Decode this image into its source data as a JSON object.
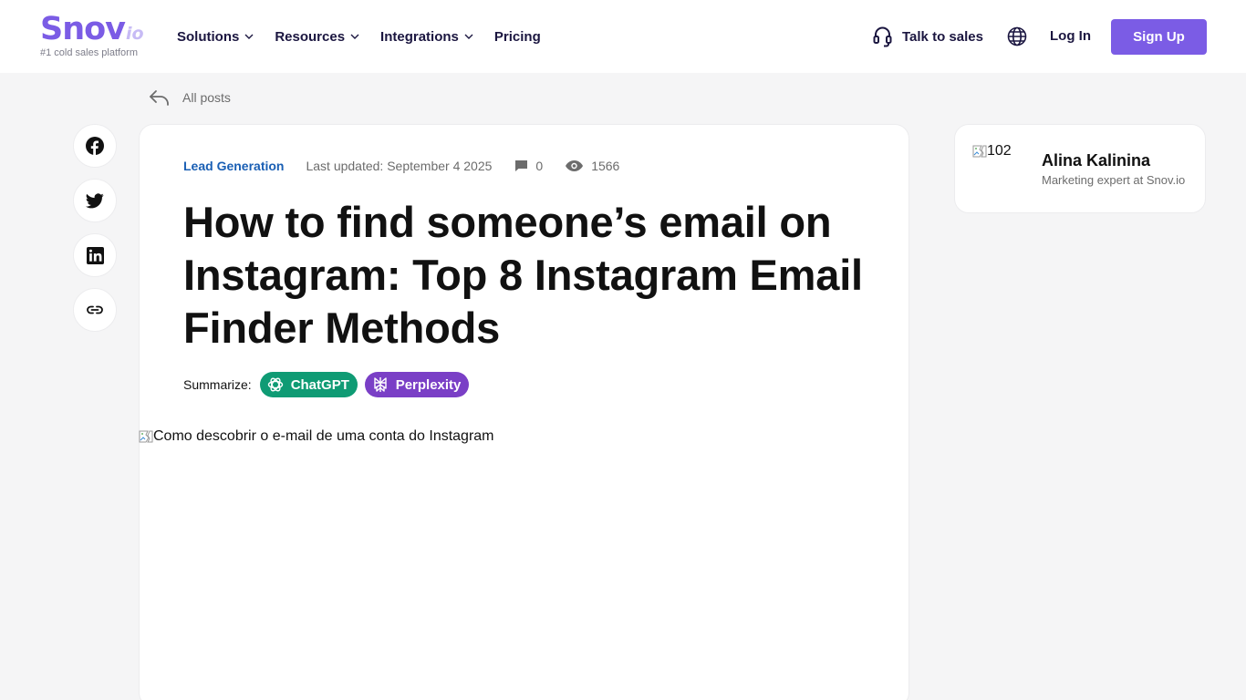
{
  "header": {
    "logo": {
      "main": "Snov",
      "suffix": "io",
      "tagline": "#1 cold sales platform"
    },
    "nav": [
      {
        "label": "Solutions",
        "has_dropdown": true
      },
      {
        "label": "Resources",
        "has_dropdown": true
      },
      {
        "label": "Integrations",
        "has_dropdown": true
      },
      {
        "label": "Pricing",
        "has_dropdown": false
      }
    ],
    "talk_to_sales": "Talk to sales",
    "language_icon": "globe-icon",
    "login": "Log In",
    "signup": "Sign Up"
  },
  "back_link": "All posts",
  "share": {
    "icons": [
      "facebook-icon",
      "twitter-icon",
      "linkedin-icon",
      "link-icon"
    ]
  },
  "article": {
    "category": "Lead Generation",
    "last_updated": "Last updated: September 4 2025",
    "comments": "0",
    "views": "1566",
    "title": "How to find someone’s email on Instagram: Top 8 Instagram Email Finder Methods",
    "summarize_label": "Summarize:",
    "summarize_chatgpt": "ChatGPT",
    "summarize_perplexity": "Perplexity",
    "hero_alt": "Como descobrir o e-mail de uma conta do Instagram"
  },
  "author": {
    "avatar_alt": "102",
    "name": "Alina Kalinina",
    "role": "Marketing expert at Snov.io"
  },
  "colors": {
    "brand": "#7b5ce5",
    "chatgpt": "#0f9b74",
    "perplexity": "#7a3fc6",
    "category": "#1a5fb4",
    "background": "#f5f5f6"
  }
}
